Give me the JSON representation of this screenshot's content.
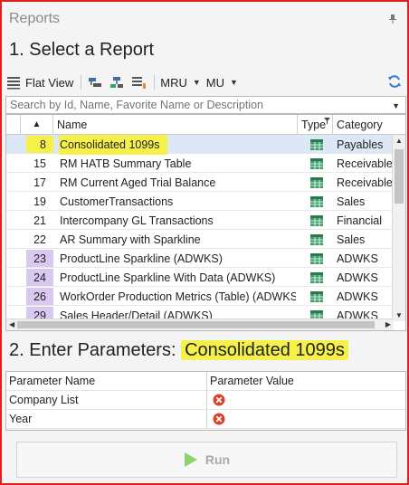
{
  "panel": {
    "title": "Reports"
  },
  "section1": {
    "title": "1. Select a Report"
  },
  "toolbar": {
    "flat_view_label": "Flat View",
    "mru_label": "MRU",
    "mu_label": "MU"
  },
  "search": {
    "placeholder": "Search by Id, Name, Favorite Name or Description"
  },
  "grid": {
    "sort_glyph": "▲",
    "columns": {
      "name": "Name",
      "type": "Type",
      "category": "Category"
    },
    "rows": [
      {
        "id": "8",
        "name": "Consolidated 1099s",
        "category": "Payables",
        "selected": true,
        "marker": "yellow"
      },
      {
        "id": "15",
        "name": "RM HATB Summary Table",
        "category": "Receivables"
      },
      {
        "id": "17",
        "name": "RM Current Aged Trial Balance",
        "category": "Receivables"
      },
      {
        "id": "19",
        "name": "CustomerTransactions",
        "category": "Sales"
      },
      {
        "id": "21",
        "name": "Intercompany GL Transactions",
        "category": "Financial"
      },
      {
        "id": "22",
        "name": "AR Summary with Sparkline",
        "category": "Sales"
      },
      {
        "id": "23",
        "name": "ProductLine Sparkline (ADWKS)",
        "category": "ADWKS",
        "marker": "purple"
      },
      {
        "id": "24",
        "name": "ProductLine Sparkline With Data (ADWKS)",
        "category": "ADWKS",
        "marker": "purple"
      },
      {
        "id": "26",
        "name": "WorkOrder Production Metrics (Table) (ADWKS)",
        "category": "ADWKS",
        "marker": "purple"
      },
      {
        "id": "29",
        "name": "Sales Header/Detail (ADWKS)",
        "category": "ADWKS",
        "marker": "purple"
      }
    ]
  },
  "section2": {
    "title_prefix": "2. Enter Parameters:",
    "report_name": "Consolidated 1099s"
  },
  "params": {
    "headers": {
      "name": "Parameter Name",
      "value": "Parameter Value"
    },
    "rows": [
      {
        "name": "Company List"
      },
      {
        "name": "Year"
      }
    ]
  },
  "run": {
    "label": "Run"
  },
  "colors": {
    "highlight": "#f5f04a",
    "marker_purple": "#d9c8ef",
    "selected_row": "#dce8f5",
    "type_icon": "#3a9e6a",
    "error": "#d8452c",
    "run_icon": "#8fd36b"
  }
}
